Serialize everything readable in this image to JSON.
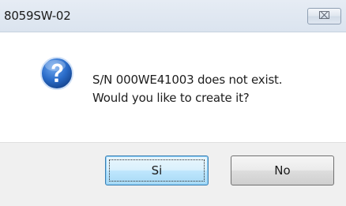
{
  "window": {
    "title": "8059SW-02",
    "close_glyph": "⌧"
  },
  "message": {
    "line1": "S/N 000WE41003 does not exist.",
    "line2": "Would you like to create it?",
    "icon": "question-icon"
  },
  "buttons": {
    "yes_label": "Si",
    "no_label": "No"
  },
  "colors": {
    "icon_blue": "#1f5fb6",
    "default_button_border": "#3c7fb1"
  }
}
